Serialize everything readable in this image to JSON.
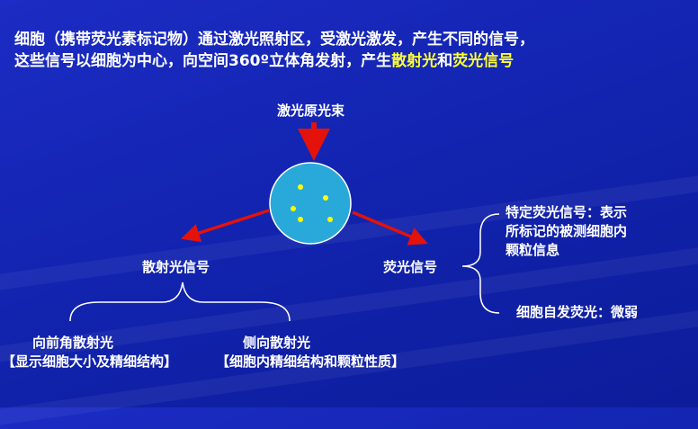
{
  "headline": {
    "line1": "细胞（携带荧光素标记物）通过激光照射区，受激光激发，产生不同的信号，",
    "line2_prefix": "这些信号以细胞为中心，向空间360º立体角发射，产生",
    "line2_hl1": "散射光",
    "line2_mid": "和",
    "line2_hl2": "荧光信号"
  },
  "diagram": {
    "laser_label": "激光原光束",
    "scatter_label": "散射光信号",
    "fluor_label": "荧光信号",
    "forward_scatter": "向前角散射光",
    "forward_scatter_note": "【显示细胞大小及精细结构】",
    "side_scatter": "侧向散射光",
    "side_scatter_note": "【细胞内精细结构和颗粒性质】",
    "specific_fluor_line1": "特定荧光信号：表示",
    "specific_fluor_line2": "所标记的被测细胞内",
    "specific_fluor_line3": "颗粒信息",
    "auto_fluor": "细胞自发荧光：微弱"
  },
  "colors": {
    "background": "#1224b0",
    "highlight": "#ffff33",
    "arrow": "#e3120b",
    "cell_fill": "#29a9d9",
    "dots": "#ffff00"
  }
}
